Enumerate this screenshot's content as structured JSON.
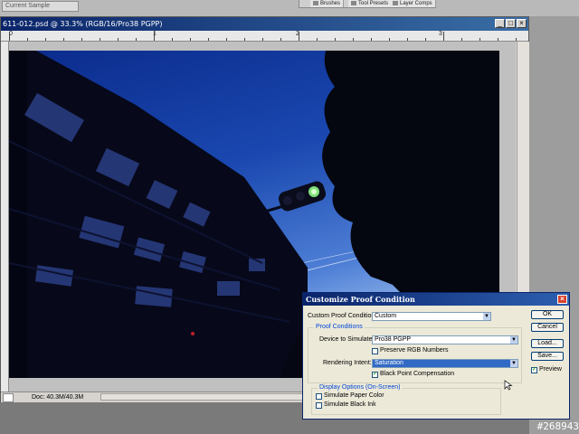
{
  "app": {
    "sample_field": "Current Sample",
    "palette_tabs": [
      "Brushes",
      "Tool Presets",
      "Layer Comps"
    ]
  },
  "document": {
    "title": "611-012.psd @ 33.3% (RGB/16/Pro38 PGPP)",
    "ruler_labels": [
      "0",
      "1",
      "2",
      "3"
    ],
    "status": "Doc: 40.3M/40.3M",
    "min_icon": "minimize-icon",
    "max_icon": "maximize-icon",
    "close_icon": "close-icon"
  },
  "dialog": {
    "title": "Customize Proof Condition",
    "custom_label": "Custom Proof Condition:",
    "custom_value": "Custom",
    "proof_group": "Proof Conditions",
    "device_label": "Device to Simulate:",
    "device_value": "Pro38 PGPP",
    "preserve_rgb": "Preserve RGB Numbers",
    "preserve_rgb_checked": false,
    "intent_label": "Rendering Intent:",
    "intent_value": "Saturation",
    "black_point": "Black Point Compensation",
    "black_point_checked": true,
    "display_group": "Display Options (On-Screen)",
    "paper_color": "Simulate Paper Color",
    "paper_color_checked": false,
    "black_ink": "Simulate Black Ink",
    "black_ink_checked": false,
    "buttons": {
      "ok": "OK",
      "cancel": "Cancel",
      "load": "Load...",
      "save": "Save..."
    },
    "preview": "Preview",
    "preview_checked": true
  },
  "watermark": "#268943",
  "colors": {
    "titlebar": "#0a246a",
    "dialog_bg": "#ece9d8",
    "selection": "#316ac5",
    "sky": "#1a48b0"
  }
}
